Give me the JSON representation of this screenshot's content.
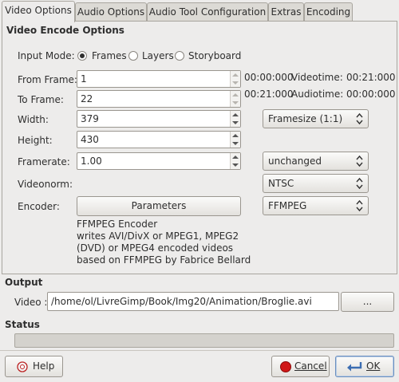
{
  "tabs": [
    {
      "label": "Video Options"
    },
    {
      "label": "Audio Options"
    },
    {
      "label": "Audio Tool Configuration"
    },
    {
      "label": "Extras"
    },
    {
      "label": "Encoding"
    }
  ],
  "video_encode": {
    "section_title": "Video Encode Options",
    "input_mode_label": "Input Mode:",
    "modes": {
      "frames": "Frames",
      "layers": "Layers",
      "storyboard": "Storyboard"
    },
    "selected_mode": "Frames",
    "from_frame_label": "From Frame:",
    "from_frame_value": "1",
    "from_time": "00:00:000",
    "videotime_label": "Videotime:",
    "videotime_value": "00:21:000",
    "to_frame_label": "To Frame:",
    "to_frame_value": "22",
    "to_time": "00:21:000",
    "audiotime_label": "Audiotime:",
    "audiotime_value": "00:00:000",
    "width_label": "Width:",
    "width_value": "379",
    "framesize_value": "Framesize (1:1)",
    "height_label": "Height:",
    "height_value": "430",
    "framerate_label": "Framerate:",
    "framerate_value": "1.00",
    "framerate_mode": "unchanged",
    "videonorm_label": "Videonorm:",
    "videonorm_value": "NTSC",
    "encoder_label": "Encoder:",
    "parameters_label": "Parameters",
    "encoder_value": "FFMPEG",
    "encoder_desc": [
      "FFMPEG Encoder",
      "writes AVI/DivX or MPEG1, MPEG2",
      "(DVD) or MPEG4 encoded videos",
      "based on FFMPEG by Fabrice Bellard"
    ]
  },
  "output": {
    "title": "Output",
    "video_label": "Video :",
    "video_path": "/home/ol/LivreGimp/Book/Img20/Animation/Broglie.avi",
    "browse_label": "..."
  },
  "status": {
    "title": "Status",
    "progress": 0
  },
  "buttons": {
    "help": "Help",
    "cancel": "Cancel",
    "ok": "OK"
  }
}
